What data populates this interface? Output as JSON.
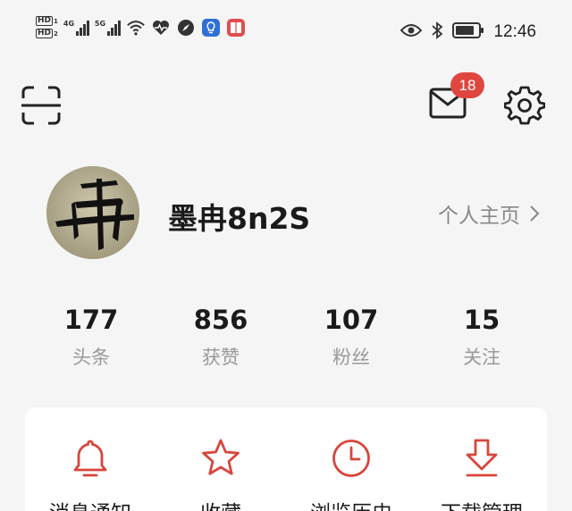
{
  "status_bar": {
    "hd1": "HD",
    "hd1_sub": "1",
    "hd2": "HD",
    "hd2_sub": "2",
    "signal1_label": "4G",
    "signal2_label": "5G",
    "time": "12:46",
    "icons": [
      "wifi-icon",
      "heart-rate-icon",
      "compass-icon",
      "bulb-app-icon",
      "book-app-icon",
      "eye-icon",
      "bluetooth-icon",
      "battery-icon"
    ]
  },
  "toolbar": {
    "icons": [
      "scan-icon",
      "mail-icon",
      "settings-icon"
    ],
    "mail_badge": "18"
  },
  "profile": {
    "username": "墨冉8n2S",
    "homepage_label": "个人主页",
    "avatar_char": "冉"
  },
  "stats": [
    {
      "value": "177",
      "label": "头条"
    },
    {
      "value": "856",
      "label": "获赞"
    },
    {
      "value": "107",
      "label": "粉丝"
    },
    {
      "value": "15",
      "label": "关注"
    }
  ],
  "tools": [
    {
      "label": "消息通知",
      "icon": "bell-icon"
    },
    {
      "label": "收藏",
      "icon": "star-icon"
    },
    {
      "label": "浏览历史",
      "icon": "clock-icon"
    },
    {
      "label": "下载管理",
      "icon": "download-icon"
    }
  ],
  "colors": {
    "accent": "#d9453b",
    "badge": "#e0463f",
    "background": "#f5f5f5",
    "muted_text": "#999999"
  }
}
